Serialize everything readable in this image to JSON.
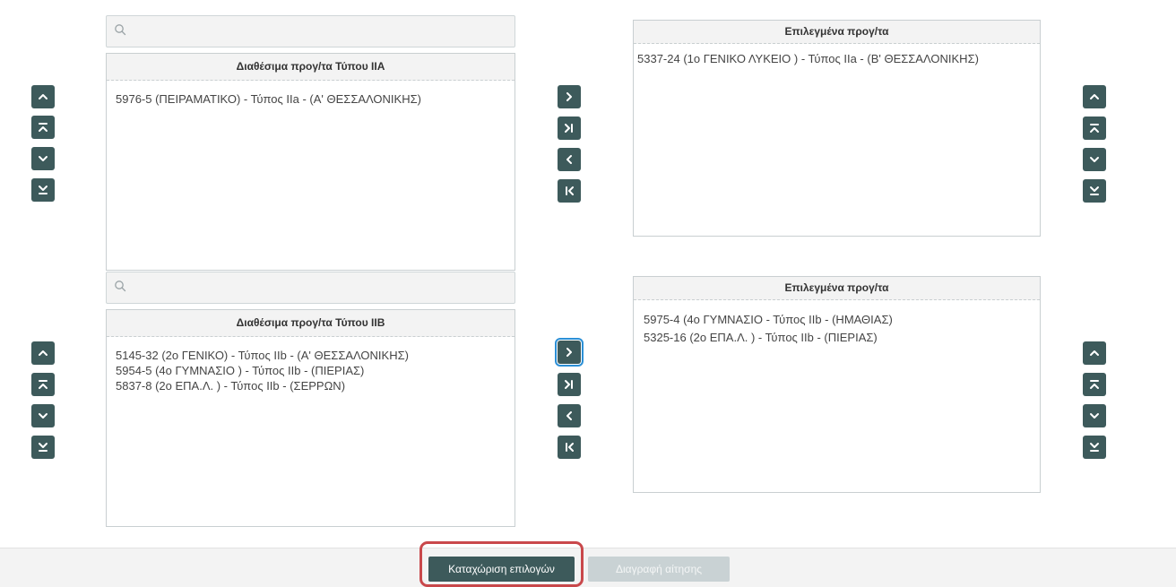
{
  "icons": {
    "up": "chevron-up-icon",
    "top": "move-to-top-icon",
    "down": "chevron-down-icon",
    "bottom": "move-to-bottom-icon",
    "move_right": "chevron-right-icon",
    "move_all_right": "move-all-right-icon",
    "move_left": "chevron-left-icon",
    "move_all_left": "move-all-left-icon",
    "search": "search-icon"
  },
  "colors": {
    "button": "#3d5a5b",
    "highlight": "#c9484b",
    "focus": "#2b8fd6"
  },
  "groupA": {
    "search": {
      "value": "",
      "placeholder": ""
    },
    "available": {
      "title": "Διαθέσιμα προγ/τα Τύπου ΙΙΑ",
      "items": [
        "5976-5 (ΠΕΙΡΑΜΑΤΙΚΟ) - Τύπος IIa - (Α' ΘΕΣΣΑΛΟΝΙΚΗΣ)"
      ]
    },
    "selected": {
      "title": "Επιλεγμένα προγ/τα",
      "items": [
        "5337-24 (1ο ΓΕΝΙΚΟ ΛΥΚΕΙΟ ) - Τύπος IIa - (Β' ΘΕΣΣΑΛΟΝΙΚΗΣ)"
      ]
    }
  },
  "groupB": {
    "search": {
      "value": "",
      "placeholder": ""
    },
    "available": {
      "title": "Διαθέσιμα προγ/τα Τύπου ΙΙΒ",
      "items": [
        "5145-32 (2ο ΓΕΝΙΚΟ) - Τύπος IIb - (Α' ΘΕΣΣΑΛΟΝΙΚΗΣ)",
        "5954-5 (4ο ΓΥΜΝΑΣΙΟ ) - Τύπος IIb - (ΠΙΕΡΙΑΣ)",
        "5837-8 (2ο ΕΠΑ.Λ. ) - Τύπος IIb - (ΣΕΡΡΩΝ)"
      ]
    },
    "selected": {
      "title": "Επιλεγμένα προγ/τα",
      "items": [
        "5975-4 (4ο ΓΥΜΝΑΣΙΟ - Τύπος IIb - (ΗΜΑΘΙΑΣ)",
        "5325-16 (2ο ΕΠΑ.Λ. ) - Τύπος IIb - (ΠΙΕΡΙΑΣ)"
      ]
    }
  },
  "footer": {
    "submit_label": "Καταχώριση επιλογών",
    "delete_label": "Διαγραφή αίτησης"
  }
}
